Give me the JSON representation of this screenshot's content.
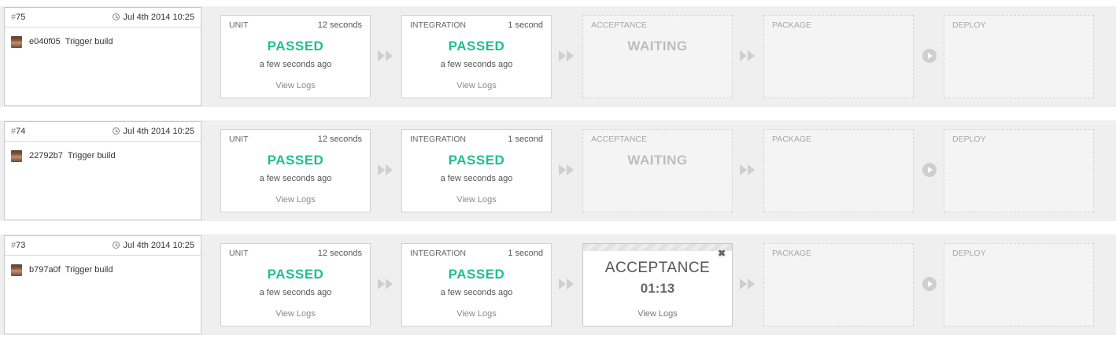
{
  "builds": [
    {
      "number": "75",
      "date": "Jul 4th 2014 10:25",
      "commit": "e040f05",
      "message": "Trigger build",
      "stages": [
        {
          "name": "UNIT",
          "duration": "12 seconds",
          "status": "PASSED",
          "ago": "a few seconds ago",
          "logs": "View Logs"
        },
        {
          "name": "INTEGRATION",
          "duration": "1 second",
          "status": "PASSED",
          "ago": "a few seconds ago",
          "logs": "View Logs"
        },
        {
          "name": "ACCEPTANCE",
          "status": "WAITING"
        },
        {
          "name": "PACKAGE"
        },
        {
          "name": "DEPLOY"
        }
      ]
    },
    {
      "number": "74",
      "date": "Jul 4th 2014 10:25",
      "commit": "22792b7",
      "message": "Trigger build",
      "stages": [
        {
          "name": "UNIT",
          "duration": "12 seconds",
          "status": "PASSED",
          "ago": "a few seconds ago",
          "logs": "View Logs"
        },
        {
          "name": "INTEGRATION",
          "duration": "1 second",
          "status": "PASSED",
          "ago": "a few seconds ago",
          "logs": "View Logs"
        },
        {
          "name": "ACCEPTANCE",
          "status": "WAITING"
        },
        {
          "name": "PACKAGE"
        },
        {
          "name": "DEPLOY"
        }
      ]
    },
    {
      "number": "73",
      "date": "Jul 4th 2014 10:25",
      "commit": "b797a0f",
      "message": "Trigger build",
      "stages": [
        {
          "name": "UNIT",
          "duration": "12 seconds",
          "status": "PASSED",
          "ago": "a few seconds ago",
          "logs": "View Logs"
        },
        {
          "name": "INTEGRATION",
          "duration": "1 second",
          "status": "PASSED",
          "ago": "a few seconds ago",
          "logs": "View Logs"
        },
        {
          "name": "ACCEPTANCE",
          "timer": "01:13",
          "logs": "View Logs"
        },
        {
          "name": "PACKAGE"
        },
        {
          "name": "DEPLOY"
        }
      ]
    }
  ],
  "icons": {
    "arrow": "double-chevron-right-icon",
    "play": "play-icon",
    "close": "close-icon",
    "clock": "clock-icon"
  },
  "colors": {
    "passed": "#1fbf8f",
    "waiting": "#bdbdbd",
    "row_bg": "#efefef"
  }
}
